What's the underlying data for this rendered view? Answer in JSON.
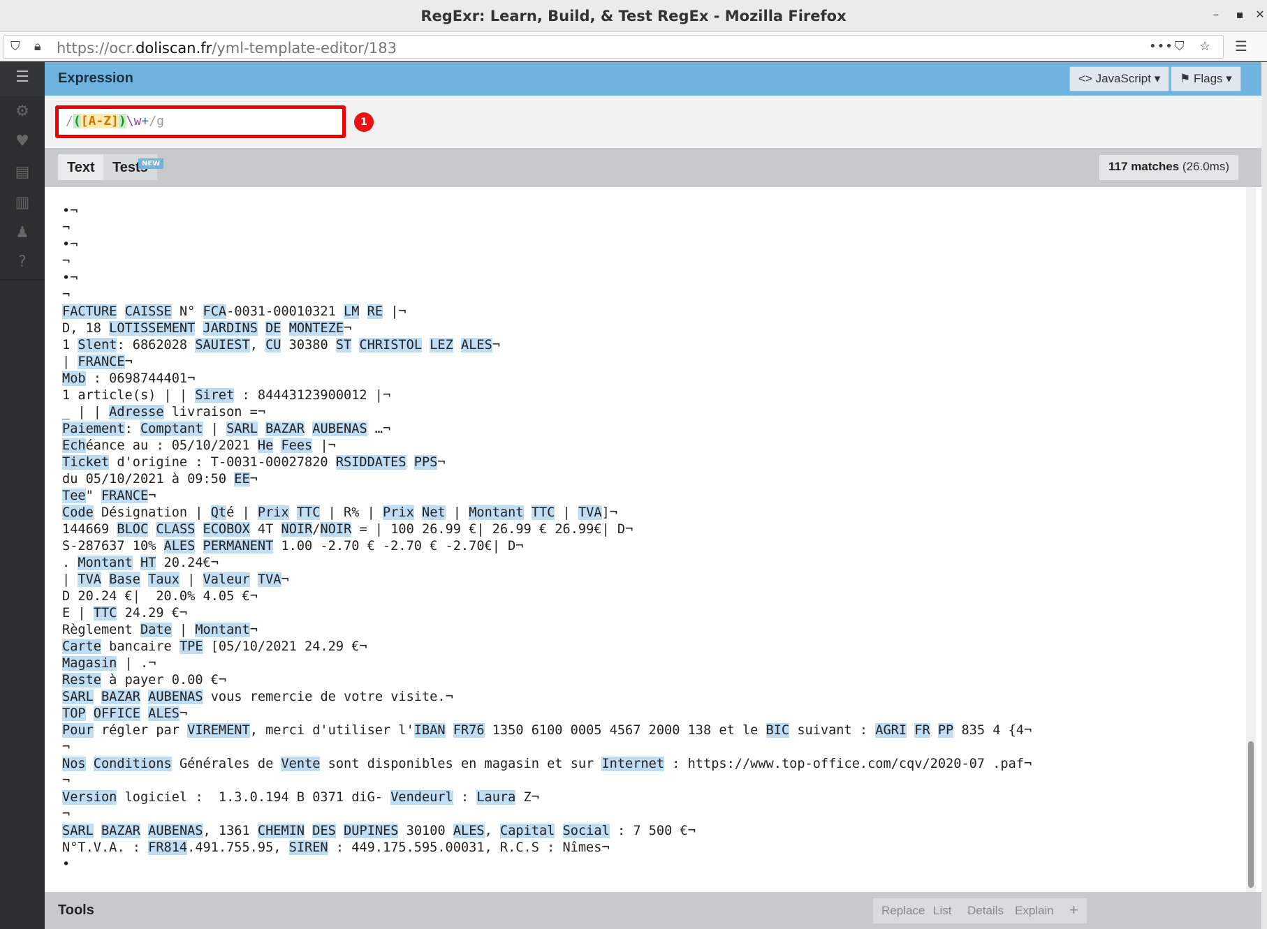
{
  "window": {
    "title": "RegExr: Learn, Build, & Test RegEx - Mozilla Firefox"
  },
  "urlbar": {
    "prefix": "https://ocr.",
    "domain": "doliscan.fr",
    "path": "/yml-template-editor/183"
  },
  "expression": {
    "header": "Expression",
    "language_label": "JavaScript",
    "flags_label": "Flags",
    "open": "/",
    "group_open": "(",
    "set": "[A-Z]",
    "group_close": ")",
    "escape": "\\w",
    "quant": "+",
    "close": "/g",
    "badge": "1"
  },
  "tabs": {
    "text": "Text",
    "tests": "Tests",
    "new_badge": "NEW",
    "matches_count": "117 matches",
    "matches_time": "(26.0ms)"
  },
  "tools": {
    "label": "Tools",
    "buttons": [
      "Replace",
      "List",
      "Details",
      "Explain"
    ],
    "add": "+"
  },
  "text_lines": [
    "•¬",
    "¬",
    "•¬",
    "¬",
    "•¬",
    "¬",
    "FACTURE CAISSE N° FCA-0031-00010321 LM RE |¬",
    "D, 18 LOTISSEMENT JARDINS DE MONTEZE¬",
    "1 Slent: 6862028 SAUIEST, CU 30380 ST CHRISTOL LEZ ALES¬",
    "| FRANCE¬",
    "Mob : 0698744401¬",
    "1 article(s) | | Siret : 84443123900012 |¬",
    "_ | | Adresse livraison =¬",
    "Paiement: Comptant | SARL BAZAR AUBENAS …¬",
    "Echéance au : 05/10/2021 He Fees |¬",
    "Ticket d'origine : T-0031-00027820 RSIDDATES PPS¬",
    "du 05/10/2021 à 09:50 EE¬",
    "Tee\" FRANCE¬",
    "Code Désignation | Qté | Prix TTC | R% | Prix Net | Montant TTC | TVA]¬",
    "144669 BLOC CLASS ECOBOX 4T NOIR/NOIR = | 100 26.99 €| 26.99 € 26.99€| D¬",
    "S-287637 10% ALES PERMANENT 1.00 -2.70 € -2.70 € -2.70€| D¬",
    ". Montant HT 20.24€¬",
    "| TVA Base Taux | Valeur TVA¬",
    "D 20.24 €|  20.0% 4.05 €¬",
    "E | TTC 24.29 €¬",
    "Règlement Date | Montant¬",
    "Carte bancaire TPE [05/10/2021 24.29 €¬",
    "Magasin | .¬",
    "Reste à payer 0.00 €¬",
    "SARL BAZAR AUBENAS vous remercie de votre visite.¬",
    "TOP OFFICE ALES¬",
    "Pour régler par VIREMENT, merci d'utiliser l'IBAN FR76 1350 6100 0005 4567 2000 138 et le BIC suivant : AGRI FR PP 835 4 {4¬",
    "¬",
    "Nos Conditions Générales de Vente sont disponibles en magasin et sur Internet : https://www.top-office.com/cqv/2020-07 .paf¬",
    "¬",
    "Version logiciel :  1.3.0.194 B 0371 diG- Vendeurl : Laura Z¬",
    "¬",
    "SARL BAZAR AUBENAS, 1361 CHEMIN DES DUPINES 30100 ALES, Capital Social : 7 500 €¬",
    "N°T.V.A. : FR814.491.755.95, SIREN : 449.175.595.00031, R.C.S : Nîmes¬",
    "•"
  ]
}
